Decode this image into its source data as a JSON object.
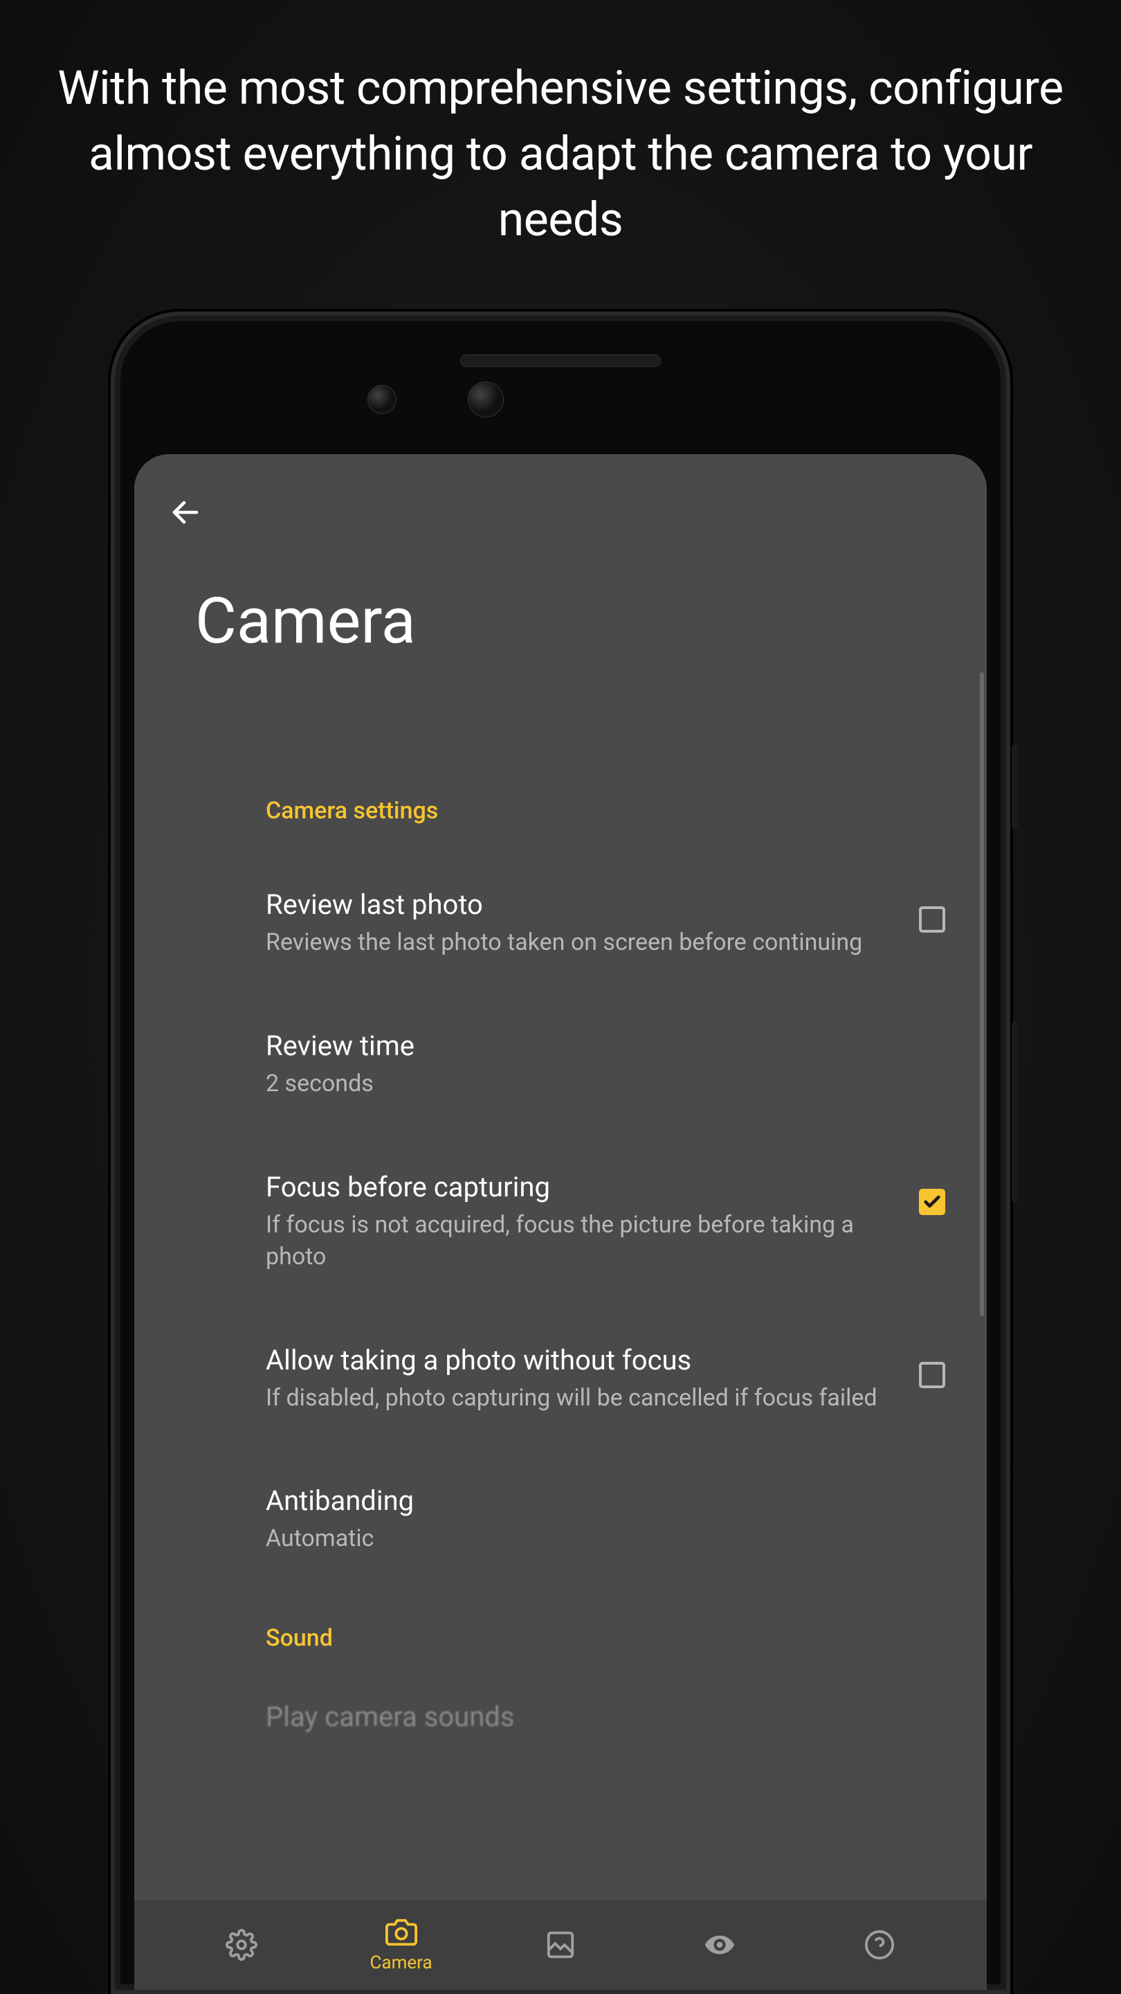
{
  "promo": "With the most comprehensive settings, configure almost everything to adapt the camera to your needs",
  "page_title": "Camera",
  "sections": {
    "camera": {
      "header": "Camera settings",
      "review_last": {
        "title": "Review last photo",
        "subtitle": "Reviews the last photo taken on screen before continuing",
        "checked": false
      },
      "review_time": {
        "title": "Review time",
        "subtitle": "2 seconds"
      },
      "focus_before": {
        "title": "Focus before capturing",
        "subtitle": "If focus is not acquired, focus the picture before taking a photo",
        "checked": true
      },
      "allow_no_focus": {
        "title": "Allow taking a photo without focus",
        "subtitle": "If disabled, photo capturing will be cancelled if focus failed",
        "checked": false
      },
      "antibanding": {
        "title": "Antibanding",
        "subtitle": "Automatic"
      }
    },
    "sound": {
      "header": "Sound",
      "cut_off": "Play camera sounds"
    }
  },
  "nav": {
    "camera_label": "Camera"
  }
}
